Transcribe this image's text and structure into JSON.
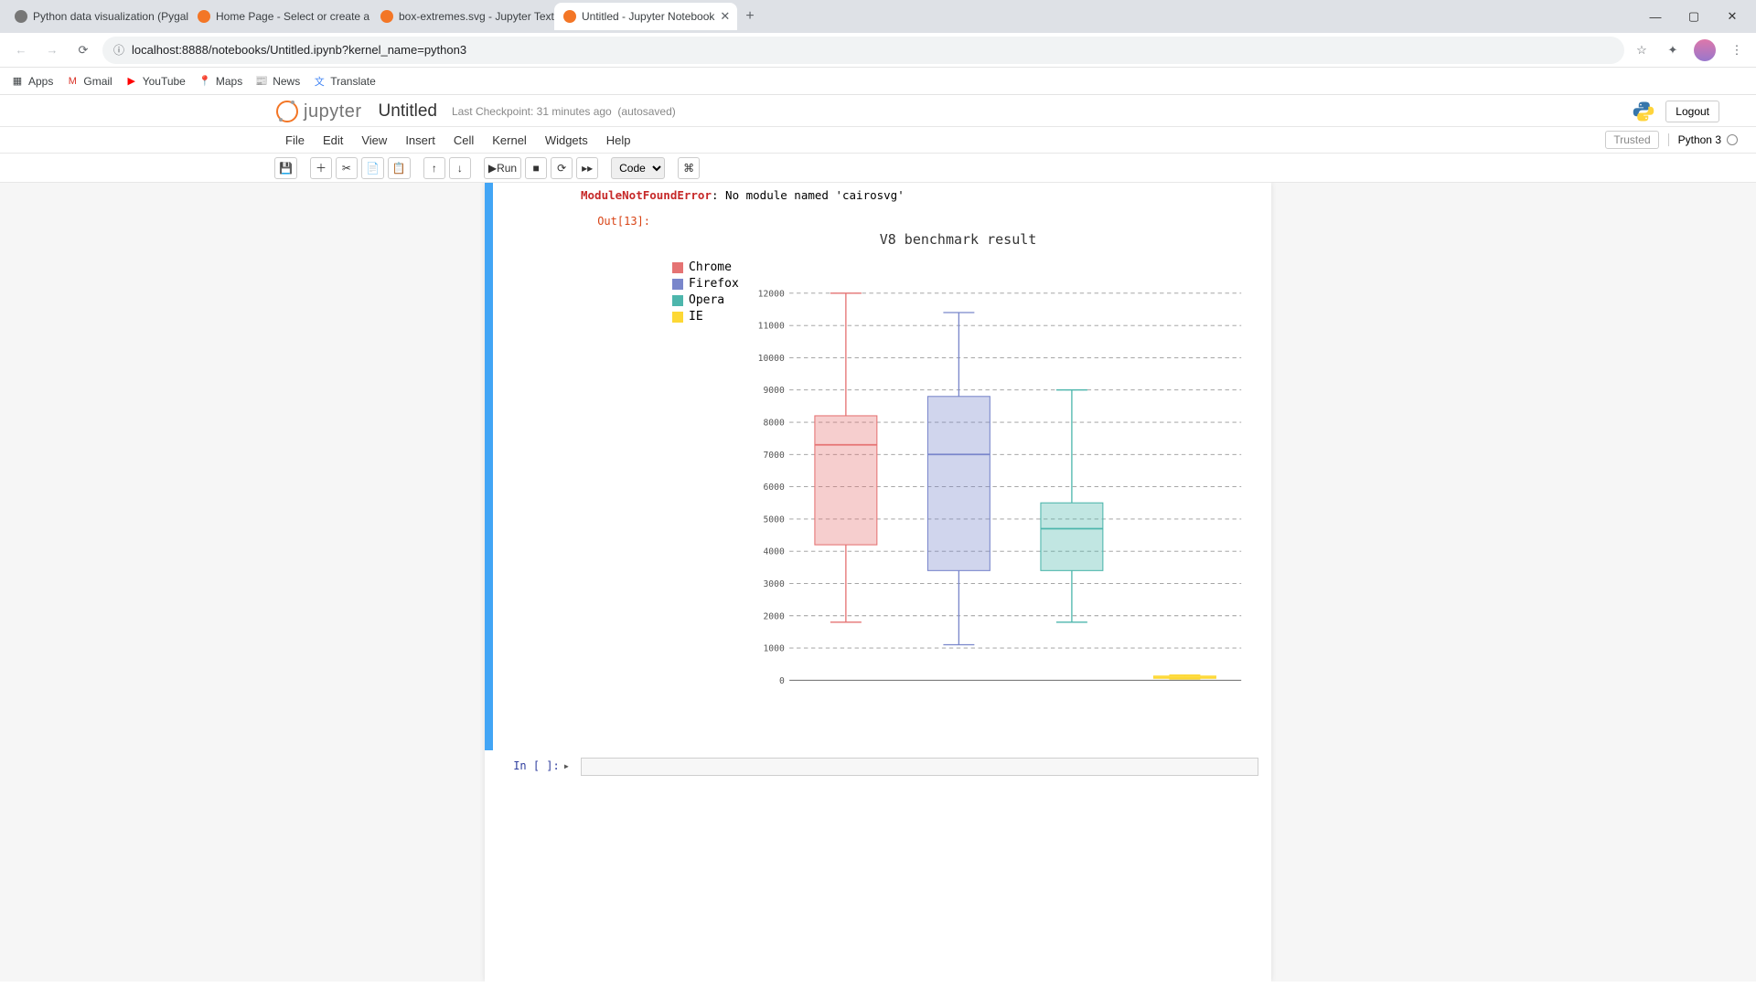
{
  "tabs": [
    {
      "title": "Python data visualization (Pygal",
      "fav": "#777"
    },
    {
      "title": "Home Page - Select or create a n",
      "fav": "#f37626"
    },
    {
      "title": "box-extremes.svg - Jupyter Text E",
      "fav": "#f37626"
    },
    {
      "title": "Untitled - Jupyter Notebook",
      "fav": "#f37626"
    }
  ],
  "url": "localhost:8888/notebooks/Untitled.ipynb?kernel_name=python3",
  "bookmarks": [
    "Apps",
    "Gmail",
    "YouTube",
    "Maps",
    "News",
    "Translate"
  ],
  "jup": {
    "word": "jupyter",
    "nb_title": "Untitled",
    "ckpt": "Last Checkpoint: 31 minutes ago",
    "autosave": "(autosaved)",
    "logout": "Logout",
    "trusted": "Trusted",
    "kernel": "Python 3"
  },
  "menu": [
    "File",
    "Edit",
    "View",
    "Insert",
    "Cell",
    "Kernel",
    "Widgets",
    "Help"
  ],
  "toolbar_run": "Run",
  "cell_type": "Code",
  "error": {
    "type": "ModuleNotFoundError",
    "msg": ": No module named 'cairosvg'"
  },
  "out_prompt": "Out[13]:",
  "in_prompt": "In [ ]:",
  "chart_data": {
    "type": "boxplot",
    "title": "V8 benchmark result",
    "ylim": [
      0,
      12000
    ],
    "yticks": [
      0,
      1000,
      2000,
      3000,
      4000,
      5000,
      6000,
      7000,
      8000,
      9000,
      10000,
      11000,
      12000
    ],
    "series": [
      {
        "name": "Chrome",
        "color": "#e57373",
        "min": 1800,
        "q1": 4200,
        "median": 7300,
        "q3": 8200,
        "max": 12000
      },
      {
        "name": "Firefox",
        "color": "#7986cb",
        "min": 1100,
        "q1": 3400,
        "median": 7000,
        "q3": 8800,
        "max": 11400
      },
      {
        "name": "Opera",
        "color": "#4db6ac",
        "min": 1800,
        "q1": 3400,
        "median": 4700,
        "q3": 5500,
        "max": 9000
      },
      {
        "name": "IE",
        "color": "#fdd835",
        "min": 40,
        "q1": 60,
        "median": 90,
        "q3": 130,
        "max": 160
      }
    ]
  }
}
